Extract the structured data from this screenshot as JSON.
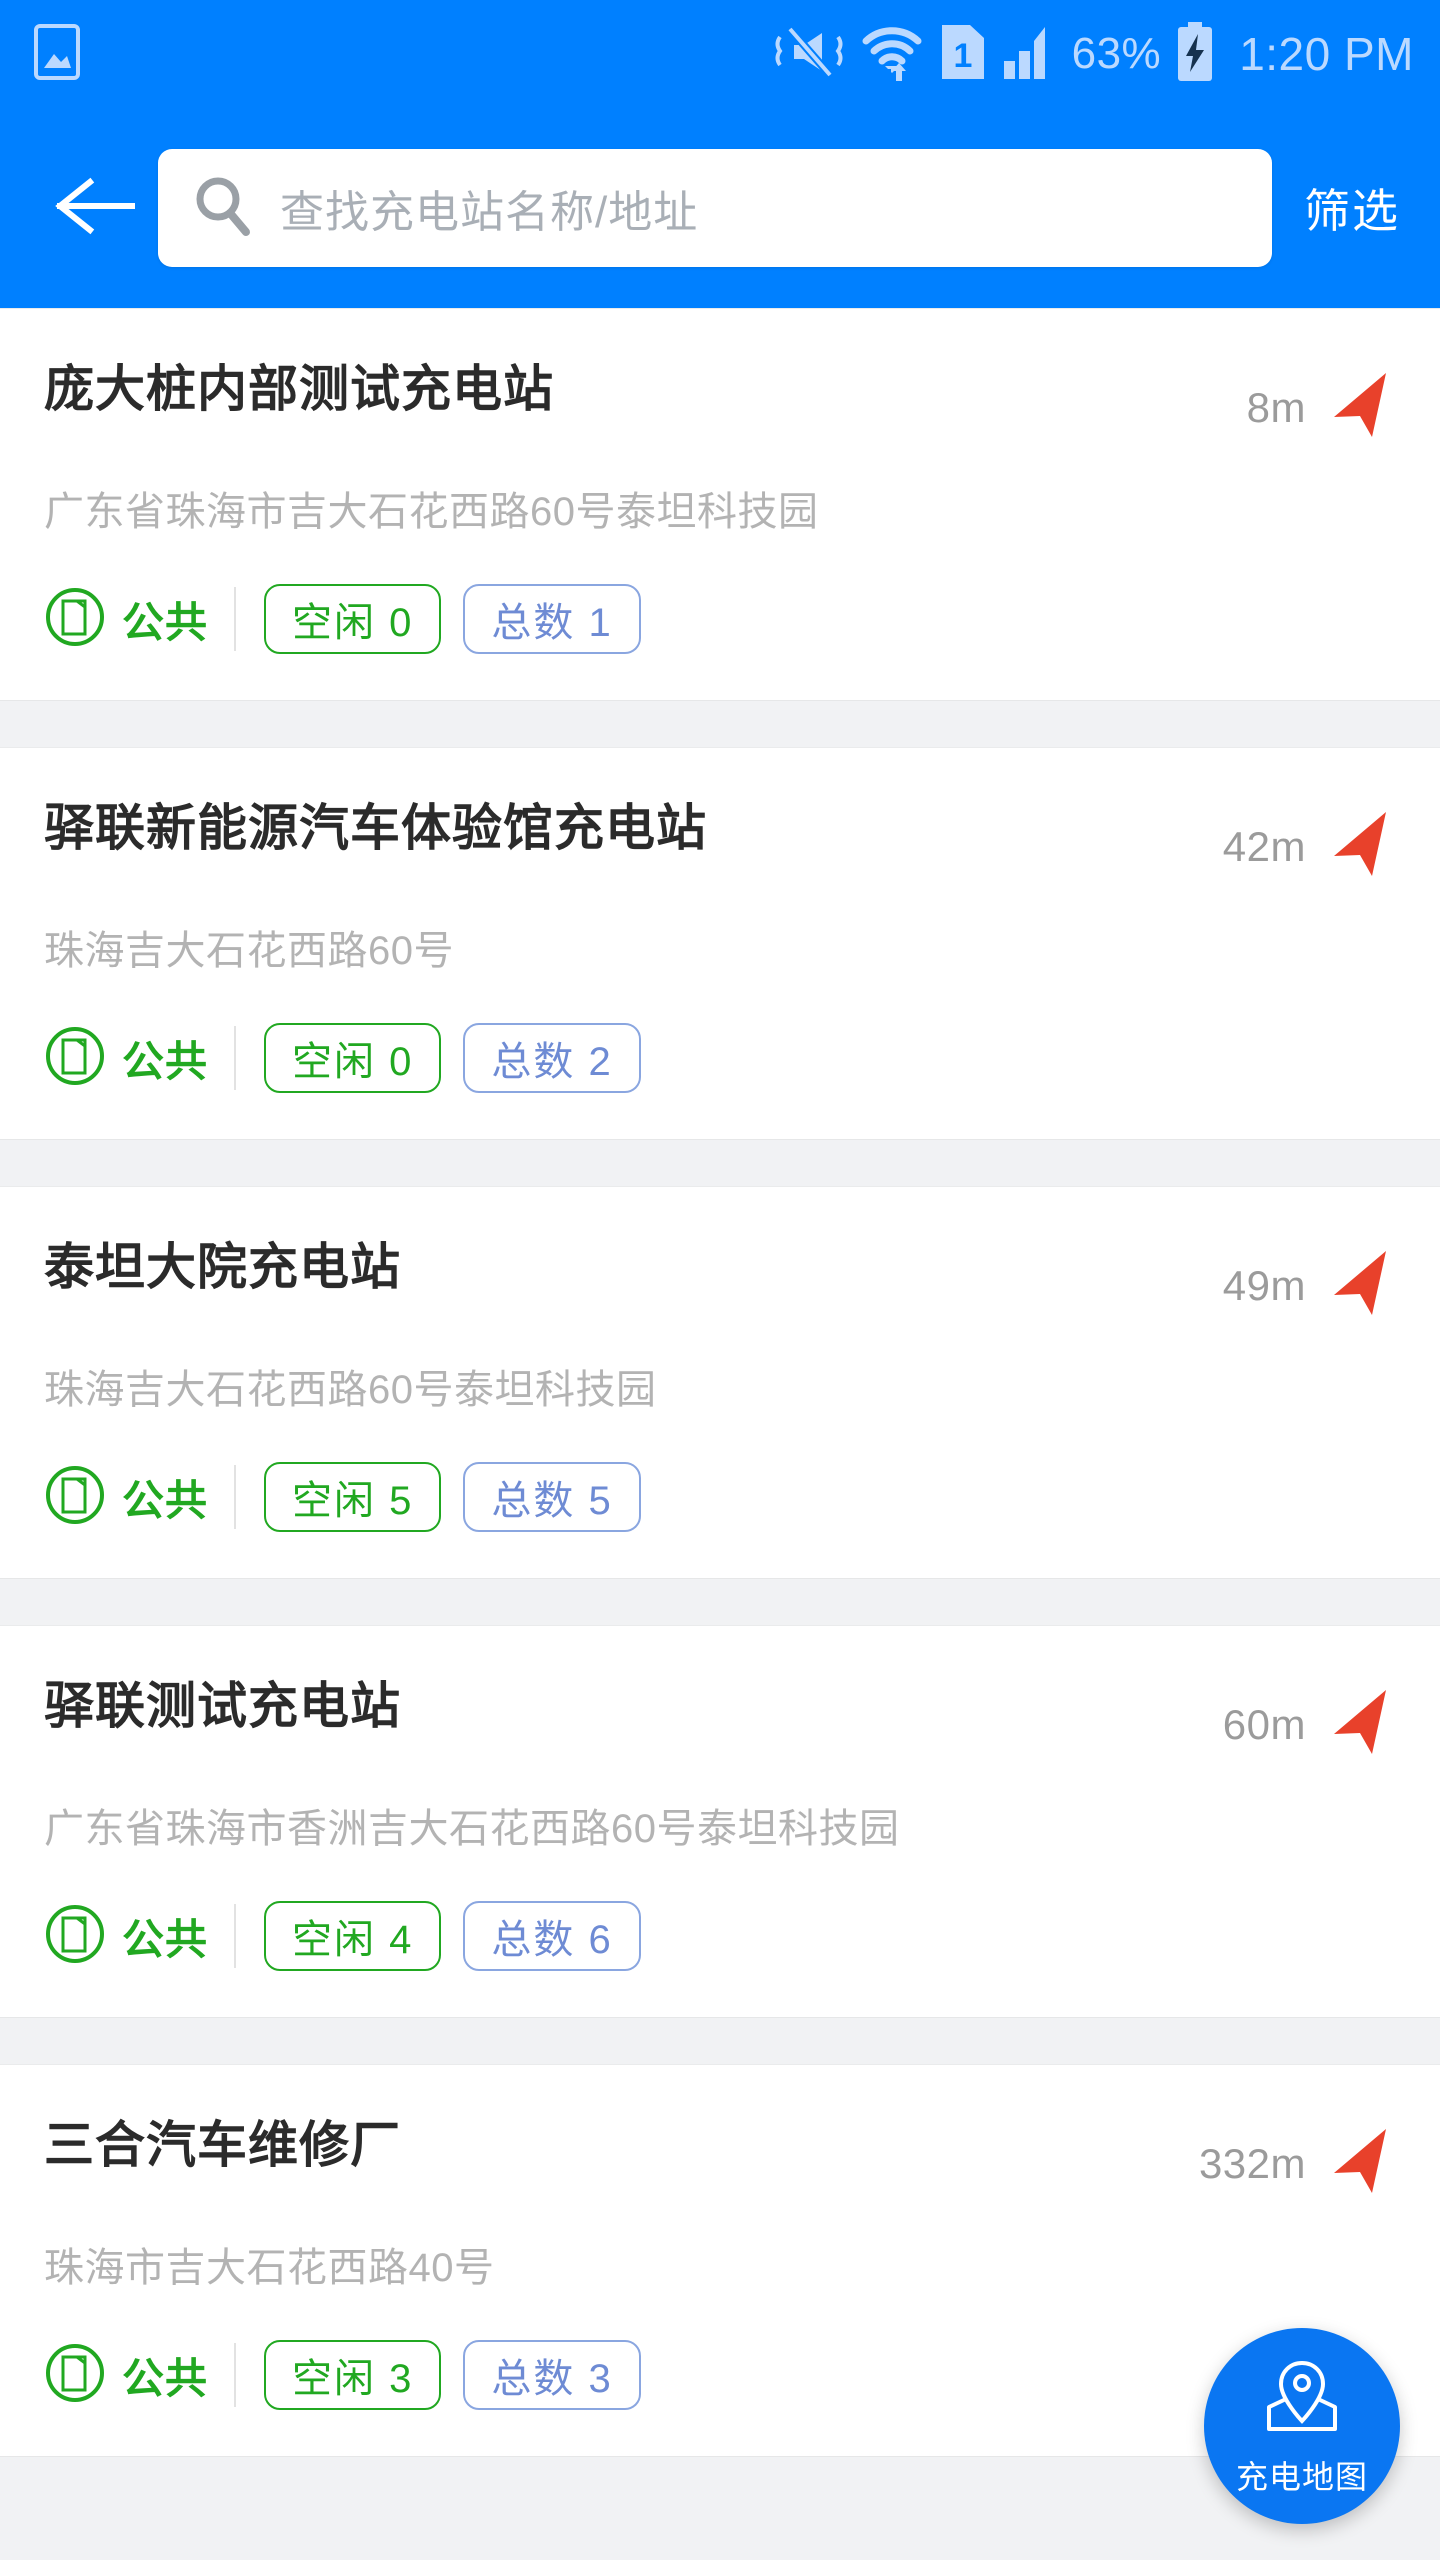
{
  "colors": {
    "brand_blue": "#0080FF",
    "fab_blue": "#0A76F2",
    "green": "#21A821",
    "chip_blue_border": "#8AA6E0",
    "chip_blue_text": "#6E8BD4",
    "nav_arrow_red": "#E8412B",
    "page_bg": "#F1F2F4"
  },
  "statusbar": {
    "icons": [
      "gallery-icon",
      "mute-vibrate-icon",
      "wifi-icon",
      "sim1-icon",
      "signal-icon"
    ],
    "battery_percent": "63%",
    "battery_icon": "battery-charging-icon",
    "time": "1:20 PM"
  },
  "appbar": {
    "back_icon": "back-arrow-icon",
    "search_icon": "search-icon",
    "search_value": "",
    "search_placeholder": "查找充电站名称/地址",
    "filter_label": "筛选"
  },
  "fab": {
    "icon": "map-pin-icon",
    "label": "充电地图"
  },
  "list": {
    "items": [
      {
        "title": "庞大桩内部测试充电站",
        "address": "广东省珠海市吉大石花西路60号泰坦科技园",
        "distance": "8m",
        "nav_icon": "navigate-arrow-icon",
        "public_icon": "charging-pile-icon",
        "public_label": "公共",
        "free_label": "空闲 0",
        "total_label": "总数 1"
      },
      {
        "title": "驿联新能源汽车体验馆充电站",
        "address": "珠海吉大石花西路60号",
        "distance": "42m",
        "nav_icon": "navigate-arrow-icon",
        "public_icon": "charging-pile-icon",
        "public_label": "公共",
        "free_label": "空闲 0",
        "total_label": "总数 2"
      },
      {
        "title": "泰坦大院充电站",
        "address": "珠海吉大石花西路60号泰坦科技园",
        "distance": "49m",
        "nav_icon": "navigate-arrow-icon",
        "public_icon": "charging-pile-icon",
        "public_label": "公共",
        "free_label": "空闲 5",
        "total_label": "总数 5"
      },
      {
        "title": "驿联测试充电站",
        "address": "广东省珠海市香洲吉大石花西路60号泰坦科技园",
        "distance": "60m",
        "nav_icon": "navigate-arrow-icon",
        "public_icon": "charging-pile-icon",
        "public_label": "公共",
        "free_label": "空闲 4",
        "total_label": "总数 6"
      },
      {
        "title": "三合汽车维修厂",
        "address": "珠海市吉大石花西路40号",
        "distance": "332m",
        "nav_icon": "navigate-arrow-icon",
        "public_icon": "charging-pile-icon",
        "public_label": "公共",
        "free_label": "空闲 3",
        "total_label": "总数 3"
      }
    ]
  }
}
